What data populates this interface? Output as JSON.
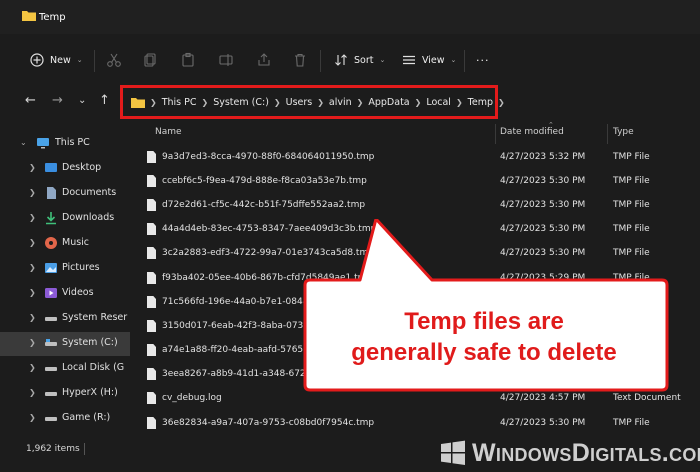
{
  "window": {
    "title": "Temp"
  },
  "toolbar": {
    "new_label": "New",
    "sort_label": "Sort",
    "view_label": "View",
    "more_label": "···"
  },
  "address": {
    "segments": [
      "This PC",
      "System (C:)",
      "Users",
      "alvin",
      "AppData",
      "Local",
      "Temp"
    ]
  },
  "sidebar": {
    "items": [
      {
        "label": "This PC",
        "icon": "pc-icon"
      },
      {
        "label": "Desktop",
        "icon": "desktop-icon"
      },
      {
        "label": "Documents",
        "icon": "documents-icon"
      },
      {
        "label": "Downloads",
        "icon": "downloads-icon"
      },
      {
        "label": "Music",
        "icon": "music-icon"
      },
      {
        "label": "Pictures",
        "icon": "pictures-icon"
      },
      {
        "label": "Videos",
        "icon": "videos-icon"
      },
      {
        "label": "System Reser",
        "icon": "drive-icon"
      },
      {
        "label": "System (C:)",
        "icon": "drive-icon"
      },
      {
        "label": "Local Disk (G",
        "icon": "drive-icon"
      },
      {
        "label": "HyperX (H:)",
        "icon": "drive-icon"
      },
      {
        "label": "Game (R:)",
        "icon": "drive-icon"
      }
    ]
  },
  "columns": {
    "name": "Name",
    "date": "Date modified",
    "type": "Type"
  },
  "files": [
    {
      "name": "9a3d7ed3-8cca-4970-88f0-684064011950.tmp",
      "date": "4/27/2023 5:32 PM",
      "type": "TMP File"
    },
    {
      "name": "ccebf6c5-f9ea-479d-888e-f8ca03a53e7b.tmp",
      "date": "4/27/2023 5:30 PM",
      "type": "TMP File"
    },
    {
      "name": "d72e2d61-cf5c-442c-b51f-75dffe552aa2.tmp",
      "date": "4/27/2023 5:30 PM",
      "type": "TMP File"
    },
    {
      "name": "44a4d4eb-83ec-4753-8347-7aee409d3c3b.tmp",
      "date": "4/27/2023 5:30 PM",
      "type": "TMP File"
    },
    {
      "name": "3c2a2883-edf3-4722-99a7-01e3743ca5d8.tmp",
      "date": "4/27/2023 5:30 PM",
      "type": "TMP File"
    },
    {
      "name": "f93ba402-05ee-40b6-867b-cfd7d5849ae1.tmp",
      "date": "4/27/2023 5:29 PM",
      "type": "TMP File"
    },
    {
      "name": "71c566fd-196e-44a0-b7e1-0848",
      "date": "",
      "type": ""
    },
    {
      "name": "3150d017-6eab-42f3-8aba-0739",
      "date": "",
      "type": ""
    },
    {
      "name": "a74e1a88-ff20-4eab-aafd-57657",
      "date": "",
      "type": ""
    },
    {
      "name": "3eea8267-a8b9-41d1-a348-6729",
      "date": "",
      "type": ""
    },
    {
      "name": "cv_debug.log",
      "date": "4/27/2023 4:57 PM",
      "type": "Text Document"
    },
    {
      "name": "36e82834-a9a7-407a-9753-c08bd0f7954c.tmp",
      "date": "4/27/2023 5:30 PM",
      "type": "TMP File"
    }
  ],
  "status": {
    "item_count": "1,962 items"
  },
  "callout": {
    "line1": "Temp files are",
    "line2": "generally safe to delete"
  },
  "watermark": {
    "text": "WindowsDigitals.com"
  },
  "colors": {
    "accent": "#e31b1b",
    "folder": "#f4c542",
    "background": "#1c1c1c"
  }
}
